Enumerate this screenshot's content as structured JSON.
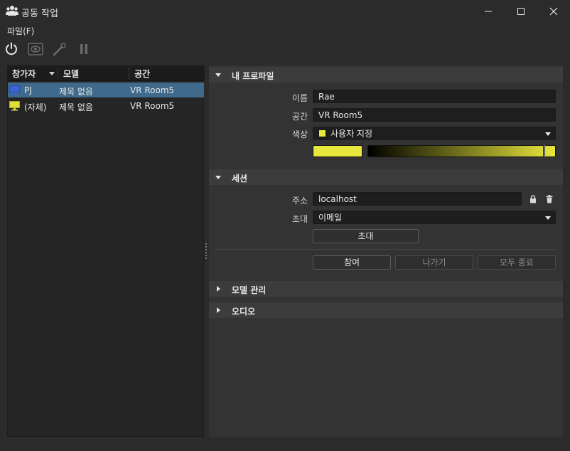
{
  "window": {
    "title": "공동 작업",
    "icon": "group-icon"
  },
  "menu": {
    "file": "파일(F)"
  },
  "toolbar": {
    "icons": [
      "power-icon",
      "eye-icon",
      "pen-icon",
      "pause-icon"
    ]
  },
  "participants": {
    "columns": [
      "참가자",
      "모델",
      "공간"
    ],
    "rows": [
      {
        "participant": "PJ",
        "model": "제목 없음",
        "space": "VR Room5",
        "color": "#3c63d6",
        "selected": true
      },
      {
        "participant": "(자체)",
        "model": "제목 없음",
        "space": "VR Room5",
        "color": "#e0e03a",
        "selected": false
      }
    ]
  },
  "profile": {
    "section": "내 프로파일",
    "name_label": "이름",
    "name_value": "Rae",
    "space_label": "공간",
    "space_value": "VR Room5",
    "color_label": "색상",
    "color_value": "사용자 지정",
    "color_hex": "#e9e83c"
  },
  "session": {
    "section": "세션",
    "address_label": "주소",
    "address_value": "localhost",
    "invite_label": "초대",
    "invite_value": "이메일",
    "invite_button": "초대",
    "join_button": "참여",
    "leave_button": "나가기",
    "end_all_button": "모두 종료"
  },
  "sections": {
    "model_manage": "모델 관리",
    "audio": "오디오"
  }
}
